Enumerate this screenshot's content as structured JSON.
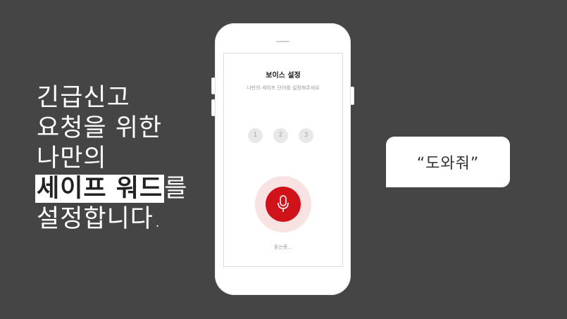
{
  "headline": {
    "line1": "긴급신고",
    "line2": "요청을 위한",
    "line3": "나만의",
    "line4_highlight": "세이프 워드",
    "line4_rest": "를",
    "line5": "설정합니다."
  },
  "screen": {
    "title": "보이스 설정",
    "subtitle": "나만의 세이프 단어를 설정해주세요",
    "steps": [
      "1",
      "2",
      "3"
    ],
    "status": "듣는중..."
  },
  "bubble": {
    "text": "“도와줘”"
  },
  "icons": {
    "mic": "microphone-icon"
  },
  "colors": {
    "background": "#454545",
    "accent": "#d0121b",
    "halo": "#f8e2e2"
  }
}
